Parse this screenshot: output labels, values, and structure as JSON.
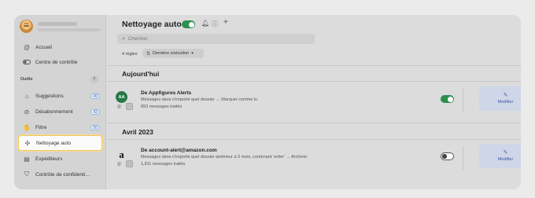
{
  "sidebar": {
    "items": [
      {
        "label": "Accueil",
        "icon": "at-sign-icon"
      },
      {
        "label": "Centre de contrôle",
        "icon": "toggle-icon"
      }
    ],
    "section": {
      "title": "Outils",
      "collapse_icon": "chevron-up-icon"
    },
    "tools": [
      {
        "label": "Suggestions",
        "icon": "lightbulb-icon",
        "badge": "40"
      },
      {
        "label": "Désabonnement",
        "icon": "unsubscribe-icon",
        "badge": "42"
      },
      {
        "label": "Filtre",
        "icon": "hand-icon",
        "badge": "50"
      },
      {
        "label": "Nettoyage auto",
        "icon": "sparkle-broom-icon",
        "badge": ""
      },
      {
        "label": "Expéditeurs",
        "icon": "senders-icon",
        "badge": ""
      },
      {
        "label": "Contrôle de confidenti…",
        "icon": "shield-icon",
        "badge": ""
      }
    ]
  },
  "main": {
    "title": "Nettoyage auto",
    "search_placeholder": "Chercher",
    "rules_count": "4 règles",
    "sort_label": "Dernière exécution",
    "groups": [
      {
        "title": "Aujourd'hui",
        "rules": [
          {
            "avatar": "AA",
            "from": "De Appfigures Alerts",
            "description": "Messages dans n'importe quel dossier → Marquer comme lu",
            "count": "893 messages traités",
            "enabled": true,
            "action": "Modifier"
          }
        ]
      },
      {
        "title": "Avril 2023",
        "rules": [
          {
            "avatar": "a",
            "from": "De account-alert@amazon.com",
            "description": "Messages dans n'importe quel dossier  antérieur à 3 mois, contenant 'order' → Archiver",
            "count": "1,811 messages traités",
            "enabled": false,
            "action": "Modifier"
          }
        ]
      }
    ]
  },
  "colors": {
    "toggle_on": "#2e8f4e",
    "active_outline": "#f2c75a",
    "badge": "#4a78c0",
    "modify_button": "#cfd6e8"
  }
}
